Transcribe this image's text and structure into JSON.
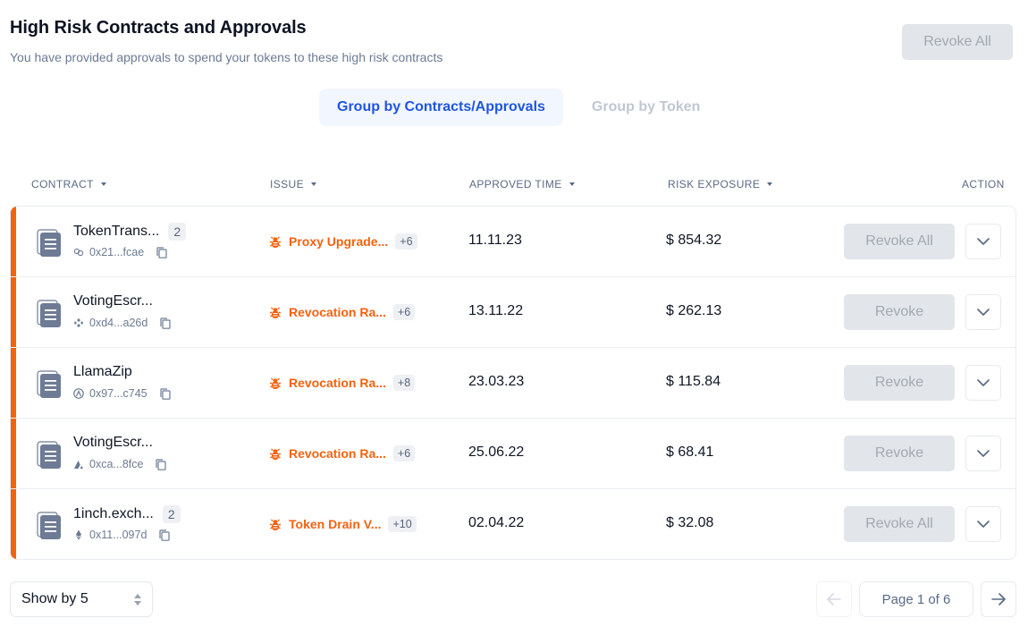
{
  "header": {
    "title": "High Risk Contracts and Approvals",
    "subtitle": "You have provided approvals to spend your tokens to these high risk contracts",
    "revoke_all_label": "Revoke All"
  },
  "tabs": [
    {
      "label": "Group by Contracts/Approvals",
      "active": true
    },
    {
      "label": "Group by Token",
      "active": false
    }
  ],
  "columns": {
    "contract": "CONTRACT",
    "issue": "ISSUE",
    "approved_time": "APPROVED TIME",
    "risk_exposure": "RISK EXPOSURE",
    "action": "ACTION"
  },
  "colors": {
    "accent": "#f4620f",
    "primary": "#1f55e0",
    "disabled_bg": "#e2e5e9"
  },
  "rows": [
    {
      "name": "TokenTrans...",
      "count": "2",
      "chain_icon": "link-icon",
      "address": "0x21...fcae",
      "issue": "Proxy Upgrade...",
      "issue_more": "+6",
      "approved": "11.11.23",
      "exposure": "$ 854.32",
      "action": "Revoke All"
    },
    {
      "name": "VotingEscr...",
      "count": "",
      "chain_icon": "bnb-icon",
      "address": "0xd4...a26d",
      "issue": "Revocation Ra...",
      "issue_more": "+6",
      "approved": "13.11.22",
      "exposure": "$ 262.13",
      "action": "Revoke"
    },
    {
      "name": "LlamaZip",
      "count": "",
      "chain_icon": "arbitrum-icon",
      "address": "0x97...c745",
      "issue": "Revocation Ra...",
      "issue_more": "+8",
      "approved": "23.03.23",
      "exposure": "$ 115.84",
      "action": "Revoke"
    },
    {
      "name": "VotingEscr...",
      "count": "",
      "chain_icon": "avalanche-icon",
      "address": "0xca...8fce",
      "issue": "Revocation Ra...",
      "issue_more": "+6",
      "approved": "25.06.22",
      "exposure": "$ 68.41",
      "action": "Revoke"
    },
    {
      "name": "1inch.exch...",
      "count": "2",
      "chain_icon": "ethereum-icon",
      "address": "0x11...097d",
      "issue": "Token Drain V...",
      "issue_more": "+10",
      "approved": "02.04.22",
      "exposure": "$ 32.08",
      "action": "Revoke All"
    }
  ],
  "pagination": {
    "page_size_label": "Show by 5",
    "page_label": "Page 1 of 6"
  }
}
